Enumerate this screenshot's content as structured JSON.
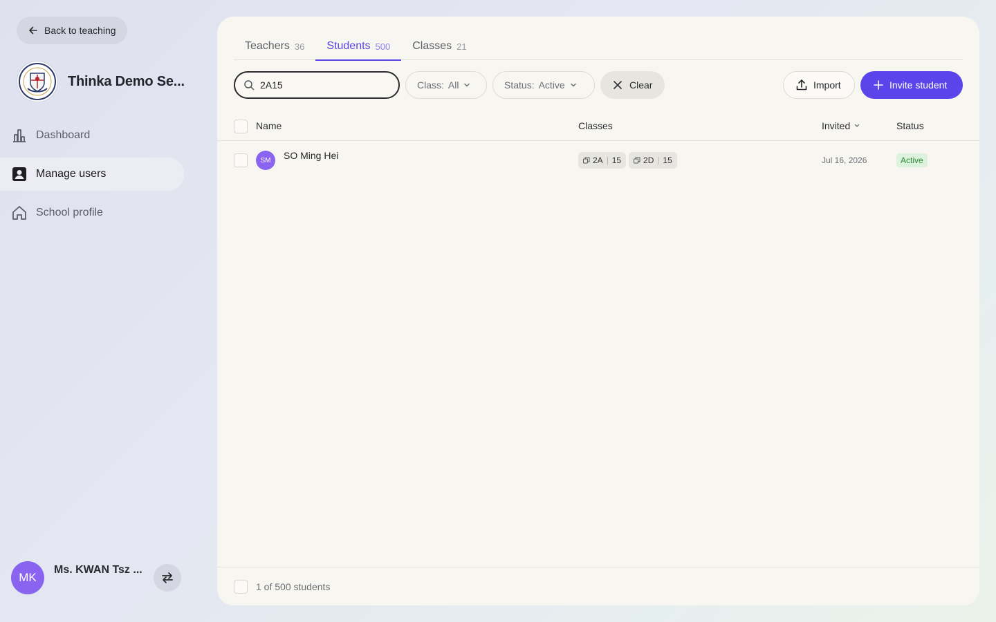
{
  "sidebar": {
    "back_label": "Back to teaching",
    "school_name": "Thinka Demo Se...",
    "nav": [
      {
        "label": "Dashboard",
        "icon": "bar-chart-icon"
      },
      {
        "label": "Manage users",
        "icon": "user-card-icon",
        "active": true
      },
      {
        "label": "School profile",
        "icon": "home-icon"
      }
    ],
    "user": {
      "initials": "MK",
      "name": "Ms. KWAN Tsz ..."
    }
  },
  "tabs": [
    {
      "label": "Teachers",
      "count": "36"
    },
    {
      "label": "Students",
      "count": "500",
      "active": true
    },
    {
      "label": "Classes",
      "count": "21"
    }
  ],
  "toolbar": {
    "search_value": "2A15",
    "class_filter": {
      "label": "Class:",
      "value": "All"
    },
    "status_filter": {
      "label": "Status:",
      "value": "Active"
    },
    "clear_label": "Clear",
    "import_label": "Import",
    "invite_label": "Invite student"
  },
  "table": {
    "columns": {
      "name": "Name",
      "classes": "Classes",
      "invited": "Invited",
      "status": "Status"
    },
    "rows": [
      {
        "initials": "SM",
        "name": "SO Ming Hei",
        "classes": [
          {
            "class": "2A",
            "number": "15"
          },
          {
            "class": "2D",
            "number": "15"
          }
        ],
        "invited": "Jul 16, 2026",
        "status": "Active"
      }
    ],
    "footer": "1 of 500 students"
  },
  "colors": {
    "accent": "#5b44ea",
    "avatar": "#8a63f0",
    "active_badge_bg": "#dcf2dc",
    "active_badge_text": "#2f8a3b"
  }
}
